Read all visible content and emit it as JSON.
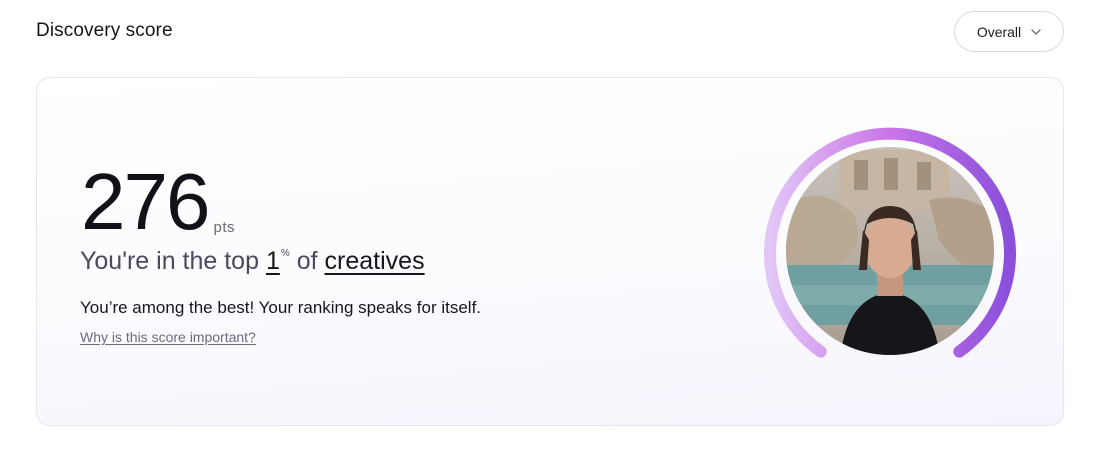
{
  "header": {
    "title": "Discovery score",
    "dropdown_value": "Overall",
    "dropdown_icon": "chevron-down-icon"
  },
  "score": {
    "value": "276",
    "unit": "pts",
    "rank_prefix": "You're in the top",
    "rank_value": "1",
    "rank_unit": "%",
    "rank_of": "of",
    "rank_group": "creatives",
    "message": "You’re among the best! Your ranking speaks for itself.",
    "why_link": "Why is this score important?"
  },
  "gauge": {
    "level_fraction": 1.0,
    "gradient_start": "#e2c6f7",
    "gradient_mid": "#c975e6",
    "gradient_end": "#8a4fdc",
    "track_color": "#e9e5f2"
  },
  "colors": {
    "text_primary": "#16161d",
    "text_muted": "#6b6b7f",
    "card_border": "#e6e6ec"
  }
}
